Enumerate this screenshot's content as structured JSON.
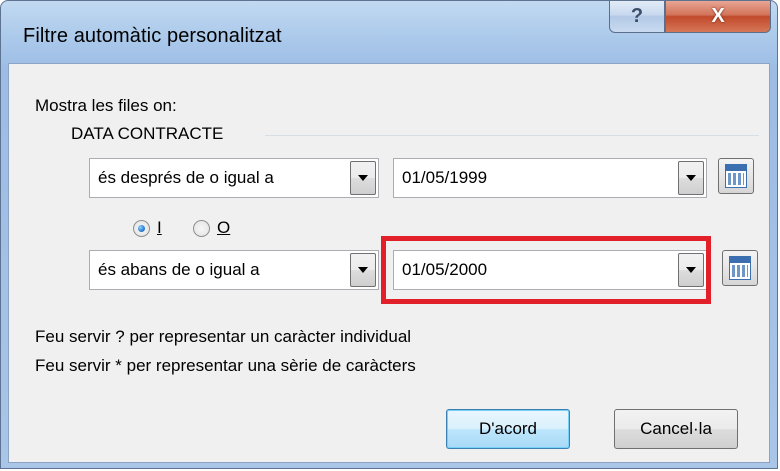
{
  "window": {
    "title": "Filtre automàtic personalitzat",
    "help_glyph": "?",
    "close_glyph": "X"
  },
  "dialog": {
    "intro": "Mostra les files on:",
    "field_name": "DATA CONTRACTE",
    "criteria1": {
      "operator": "és després de o igual a",
      "value": "01/05/1999"
    },
    "logic": {
      "and_label": "I",
      "or_label": "O",
      "selected": "I"
    },
    "criteria2": {
      "operator": "és abans de o igual a",
      "value": "01/05/2000"
    },
    "hint1": "Feu servir ? per representar un caràcter individual",
    "hint2": "Feu servir * per representar una sèrie de caràcters",
    "ok_label": "D'acord",
    "cancel_label": "Cancel·la"
  },
  "colors": {
    "highlight": "#e2202a",
    "title_bar": "#a9c8ea",
    "close_button": "#c14a2b"
  },
  "icons": [
    "help-icon",
    "close-icon",
    "dropdown-arrow-icon",
    "calendar-icon"
  ]
}
